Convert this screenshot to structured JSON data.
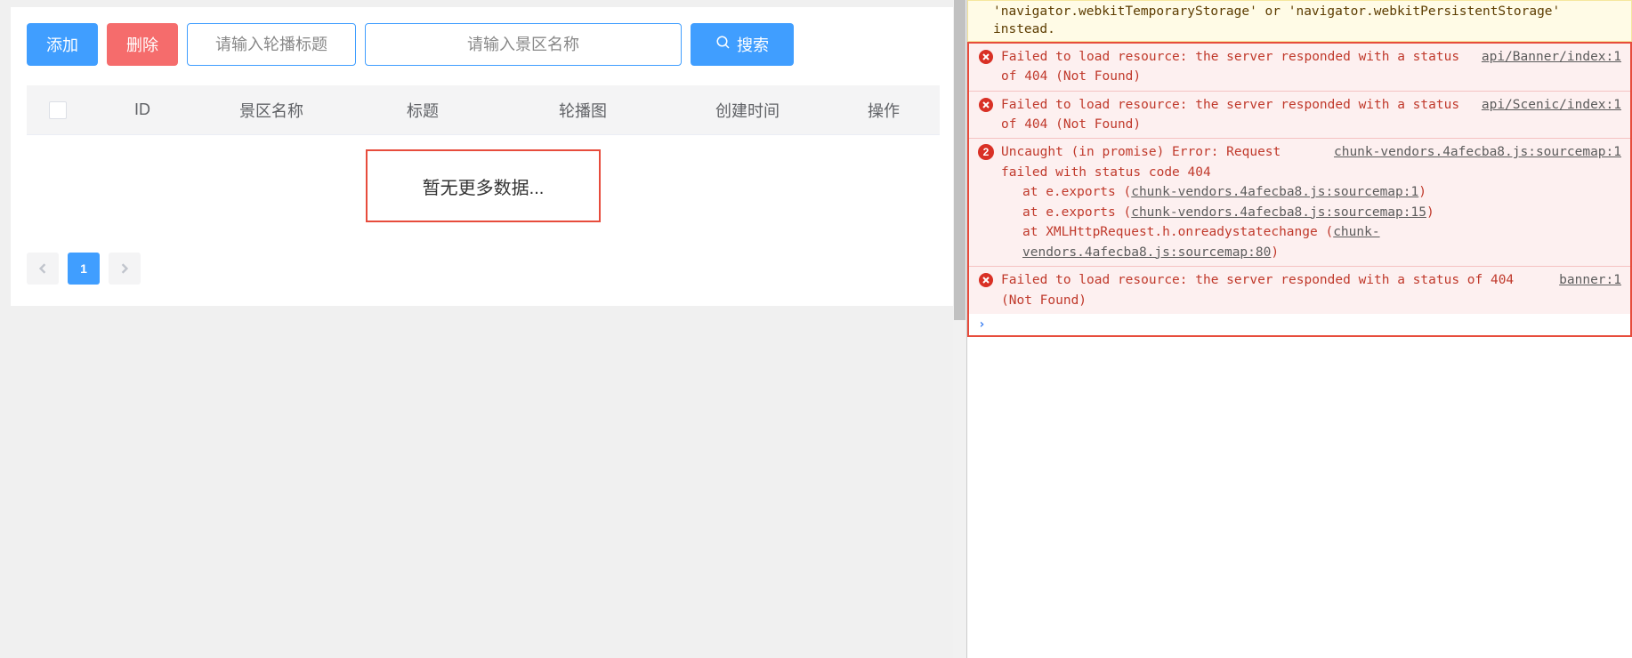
{
  "toolbar": {
    "add_label": "添加",
    "delete_label": "删除",
    "title_placeholder": "请输入轮播标题",
    "scenic_placeholder": "请输入景区名称",
    "search_label": "搜索"
  },
  "table": {
    "headers": {
      "id": "ID",
      "name": "景区名称",
      "title": "标题",
      "image": "轮播图",
      "created": "创建时间",
      "ops": "操作"
    },
    "empty_text": "暂无更多数据..."
  },
  "pagination": {
    "current": "1"
  },
  "devtools": {
    "warning": "'navigator.webkitTemporaryStorage' or 'navigator.webkitPersistentStorage' instead.",
    "errors": [
      {
        "kind": "x",
        "msg": "Failed to load resource: the server responded with a status of 404 (Not Found)",
        "source": "api/Banner/index:1"
      },
      {
        "kind": "x",
        "msg": "Failed to load resource: the server responded with a status of 404 (Not Found)",
        "source": "api/Scenic/index:1"
      },
      {
        "kind": "count",
        "badge": "2",
        "msg_head": "Uncaught (in promise) Error: Request failed with status code 404",
        "source": "chunk-vendors.4afecba8.js:sourcemap:1",
        "stack": [
          {
            "prefix": "at e.exports (",
            "link": "chunk-vendors.4afecba8.js:sourcemap:1",
            "suffix": ")"
          },
          {
            "prefix": "at e.exports (",
            "link": "chunk-vendors.4afecba8.js:sourcemap:15",
            "suffix": ")"
          },
          {
            "prefix": "at XMLHttpRequest.h.onreadystatechange (",
            "link": "chunk-vendors.4afecba8.js:sourcemap:80",
            "suffix": ")"
          }
        ]
      },
      {
        "kind": "x",
        "msg": "Failed to load resource: the server responded with a status of 404 (Not Found)",
        "source": "banner:1"
      }
    ],
    "prompt": "›"
  }
}
